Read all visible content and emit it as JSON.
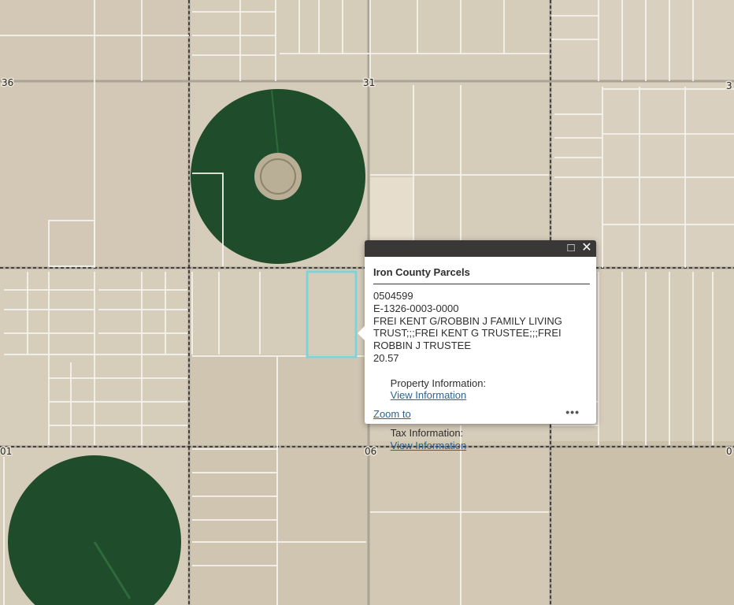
{
  "map": {
    "section_labels": [
      "36",
      "31",
      "3",
      "01",
      "06",
      "0"
    ]
  },
  "popup": {
    "title": "Iron County Parcels",
    "parcel_id": "0504599",
    "account": "E-1326-0003-0000",
    "owner": "FREI KENT G/ROBBIN J FAMILY LIVING TRUST;;;FREI KENT G TRUSTEE;;;FREI ROBBIN J TRUSTEE",
    "acreage": "20.57",
    "property_info_label": "Property Information:",
    "property_info_link": "View Information",
    "tax_info_label": "Tax Information:",
    "tax_info_link": "View Information",
    "zoom_label": "Zoom to",
    "more_label": "•••",
    "maximize_icon": "□",
    "close_icon": "✕"
  },
  "colors": {
    "desert": "#d6ccba",
    "field_green": "#1f4d2b",
    "parcel_line": "#f4f2ee",
    "selected_parcel": "#7fd3d6",
    "popup_bar": "#3a3836",
    "link": "#2a6496"
  }
}
